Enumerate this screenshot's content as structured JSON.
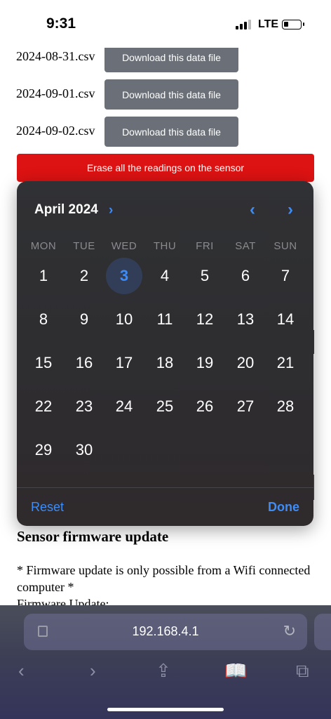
{
  "status": {
    "time": "9:31",
    "network": "LTE"
  },
  "files": [
    {
      "name": "2024-08-31.csv",
      "button": "Download this data file"
    },
    {
      "name": "2024-09-01.csv",
      "button": "Download this data file"
    },
    {
      "name": "2024-09-02.csv",
      "button": "Download this data file"
    }
  ],
  "erase_button": "Erase all the readings on the sensor",
  "firmware": {
    "title": "Sensor firmware update",
    "note": "* Firmware update is only possible from a Wifi connected computer *",
    "label": "Firmware Update:"
  },
  "calendar": {
    "month": "April 2024",
    "month_chevron": "›",
    "prev": "‹",
    "next": "›",
    "weekdays": [
      "MON",
      "TUE",
      "WED",
      "THU",
      "FRI",
      "SAT",
      "SUN"
    ],
    "days": [
      "1",
      "2",
      "3",
      "4",
      "5",
      "6",
      "7",
      "8",
      "9",
      "10",
      "11",
      "12",
      "13",
      "14",
      "15",
      "16",
      "17",
      "18",
      "19",
      "20",
      "21",
      "22",
      "23",
      "24",
      "25",
      "26",
      "27",
      "28",
      "29",
      "30"
    ],
    "selected": "3",
    "reset": "Reset",
    "done": "Done",
    "accent": "#3d8cf8"
  },
  "browser": {
    "url": "192.168.4.1",
    "back": "‹",
    "forward": "›",
    "share": "⇪",
    "bookmarks": "📖",
    "tabs": "⧉",
    "reload": "↻"
  }
}
